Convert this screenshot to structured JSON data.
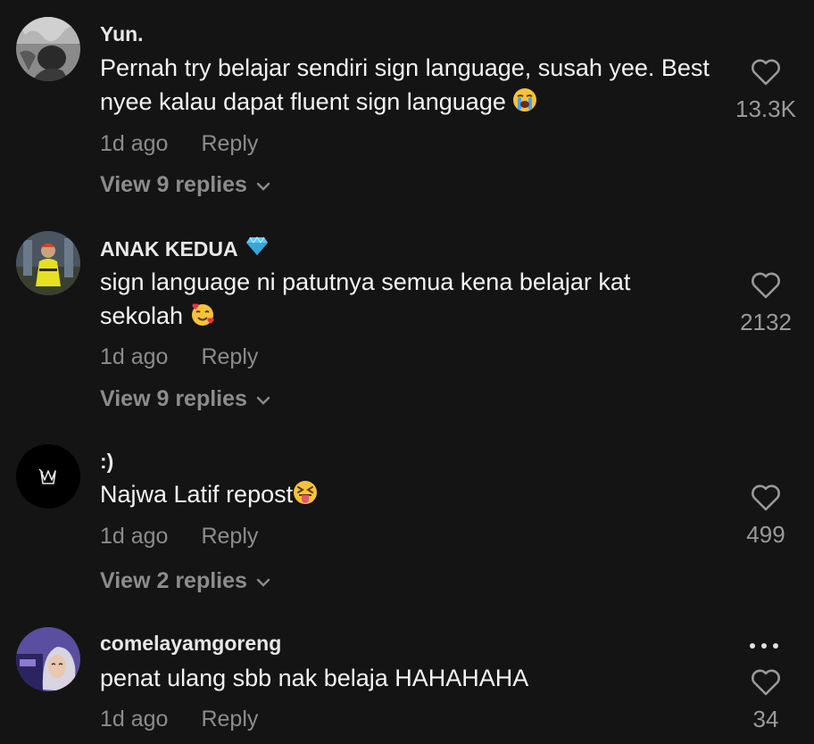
{
  "comments": [
    {
      "username": "Yun.",
      "text": "Pernah try belajar sendiri sign language, susah yee. Best nyee kalau dapat fluent sign language",
      "emoji": "loudly-crying-face",
      "time": "1d ago",
      "reply_label": "Reply",
      "view_replies": "View 9 replies",
      "likes": "13.3K"
    },
    {
      "username": "ANAK KEDUA",
      "badge_icon": "diamond-icon",
      "text": "sign language ni patutnya semua kena belajar kat sekolah",
      "emoji": "smiling-face-with-hearts",
      "time": "1d ago",
      "reply_label": "Reply",
      "view_replies": "View 9 replies",
      "likes": "2132"
    },
    {
      "username": ":)",
      "text": "Najwa Latif repost",
      "emoji": "squinting-face-with-tongue",
      "time": "1d ago",
      "reply_label": "Reply",
      "view_replies": "View 2 replies",
      "likes": "499"
    },
    {
      "username": "comelayamgoreng",
      "text": "penat ulang sbb nak belaja HAHAHAHA",
      "time": "1d ago",
      "reply_label": "Reply",
      "likes": "34",
      "more_icon": "more-dots-icon"
    }
  ],
  "colors": {
    "background": "#141414",
    "text_primary": "#f4f4f4",
    "text_secondary": "#8c8c8c",
    "diamond": "#5ec8f0"
  }
}
